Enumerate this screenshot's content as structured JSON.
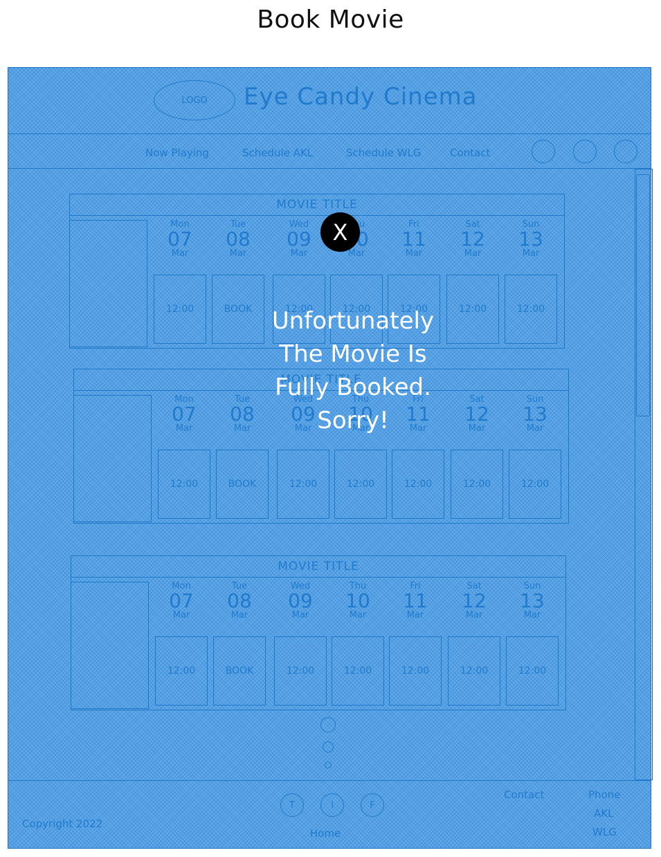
{
  "page_title": "Book Movie",
  "header": {
    "logo": "LOGO",
    "brand": "Eye Candy Cinema"
  },
  "nav": {
    "links": [
      "Now Playing",
      "Schedule AKL",
      "Schedule WLG",
      "Contact"
    ]
  },
  "movies": [
    {
      "title": "MOVIE TITLE",
      "days": [
        {
          "d": "Mon",
          "n": "07",
          "m": "Mar"
        },
        {
          "d": "Tue",
          "n": "08",
          "m": "Mar"
        },
        {
          "d": "Wed",
          "n": "09",
          "m": "Mar"
        },
        {
          "d": "Thu",
          "n": "10",
          "m": "Mar"
        },
        {
          "d": "Fri",
          "n": "11",
          "m": "Mar"
        },
        {
          "d": "Sat",
          "n": "12",
          "m": "Mar"
        },
        {
          "d": "Sun",
          "n": "13",
          "m": "Mar"
        }
      ],
      "slots": [
        "12:00",
        "BOOK",
        "12:00",
        "12:00",
        "12:00",
        "12:00",
        "12:00"
      ]
    },
    {
      "title": "MOVIE TITLE",
      "days": [
        {
          "d": "Mon",
          "n": "07",
          "m": "Mar"
        },
        {
          "d": "Tue",
          "n": "08",
          "m": "Mar"
        },
        {
          "d": "Wed",
          "n": "09",
          "m": "Mar"
        },
        {
          "d": "Thu",
          "n": "10",
          "m": "Mar"
        },
        {
          "d": "Fri",
          "n": "11",
          "m": "Mar"
        },
        {
          "d": "Sat",
          "n": "12",
          "m": "Mar"
        },
        {
          "d": "Sun",
          "n": "13",
          "m": "Mar"
        }
      ],
      "slots": [
        "12:00",
        "BOOK",
        "12:00",
        "12:00",
        "12:00",
        "12:00",
        "12:00"
      ]
    },
    {
      "title": "MOVIE TITLE",
      "days": [
        {
          "d": "Mon",
          "n": "07",
          "m": "Mar"
        },
        {
          "d": "Tue",
          "n": "08",
          "m": "Mar"
        },
        {
          "d": "Wed",
          "n": "09",
          "m": "Mar"
        },
        {
          "d": "Thu",
          "n": "10",
          "m": "Mar"
        },
        {
          "d": "Fri",
          "n": "11",
          "m": "Mar"
        },
        {
          "d": "Sat",
          "n": "12",
          "m": "Mar"
        },
        {
          "d": "Sun",
          "n": "13",
          "m": "Mar"
        }
      ],
      "slots": [
        "12:00",
        "BOOK",
        "12:00",
        "12:00",
        "12:00",
        "12:00",
        "12:00"
      ]
    }
  ],
  "footer": {
    "copyright": "Copyright 2022",
    "home": "Home",
    "contact": "Contact",
    "phone": "Phone",
    "akl": "AKL",
    "wlg": "WLG",
    "social": [
      "T",
      "I",
      "F"
    ]
  },
  "modal": {
    "close": "X",
    "lines": [
      "Unfortunately",
      "The Movie Is",
      "Fully Booked.",
      "Sorry!"
    ]
  },
  "colors": {
    "overlay": "#1e88e5",
    "wire": "#2c6aa6",
    "close_bg": "#000000"
  }
}
